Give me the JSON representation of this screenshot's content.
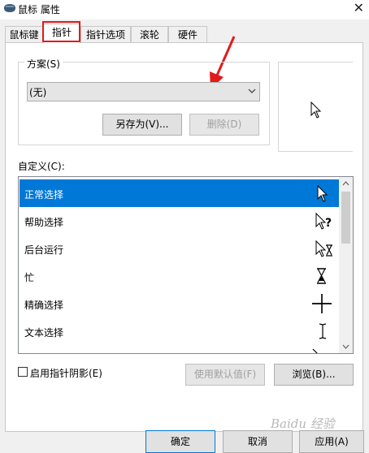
{
  "window": {
    "title": "鼠标 属性",
    "close": "✕"
  },
  "tabs": [
    {
      "label": "鼠标键"
    },
    {
      "label": "指针"
    },
    {
      "label": "指针选项"
    },
    {
      "label": "滚轮"
    },
    {
      "label": "硬件"
    }
  ],
  "active_tab": "指针",
  "scheme": {
    "label": "方案(S)",
    "selected": "(无)",
    "save_as_label": "另存为(V)...",
    "delete_label": "删除(D)"
  },
  "customize": {
    "label": "自定义(C):",
    "items": [
      {
        "label": "正常选择",
        "icon": "arrow-cursor-icon",
        "selected": true
      },
      {
        "label": "帮助选择",
        "icon": "help-cursor-icon"
      },
      {
        "label": "后台运行",
        "icon": "working-cursor-icon"
      },
      {
        "label": "忙",
        "icon": "busy-cursor-icon"
      },
      {
        "label": "精确选择",
        "icon": "crosshair-cursor-icon"
      },
      {
        "label": "文本选择",
        "icon": "text-cursor-icon"
      }
    ]
  },
  "shadow": {
    "label": "启用指针阴影(E)",
    "checked": false
  },
  "use_default_label": "使用默认值(F)",
  "browse_label": "浏览(B)...",
  "footer": {
    "ok": "确定",
    "cancel": "取消",
    "apply": "应用(A)"
  },
  "watermark": "Baidu 经验",
  "colors": {
    "accent": "#0078d7",
    "annotation": "#e11b1b"
  }
}
